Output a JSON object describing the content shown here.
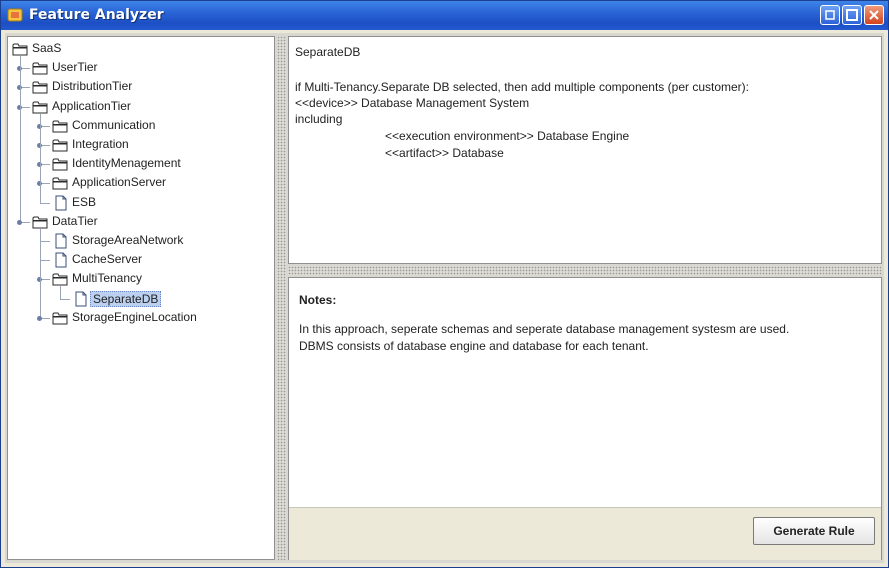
{
  "window": {
    "title": "Feature Analyzer"
  },
  "tree": {
    "nodes": [
      {
        "label": "SaaS",
        "type": "folder",
        "depth": 0
      },
      {
        "label": "UserTier",
        "type": "folder",
        "depth": 1,
        "toggle": true
      },
      {
        "label": "DistributionTier",
        "type": "folder",
        "depth": 1,
        "toggle": true
      },
      {
        "label": "ApplicationTier",
        "type": "folder",
        "depth": 1,
        "toggle": true,
        "expanded": true
      },
      {
        "label": "Communication",
        "type": "folder",
        "depth": 2,
        "toggle": true
      },
      {
        "label": "Integration",
        "type": "folder",
        "depth": 2,
        "toggle": true
      },
      {
        "label": "IdentityMenagement",
        "type": "folder",
        "depth": 2,
        "toggle": true
      },
      {
        "label": "ApplicationServer",
        "type": "folder",
        "depth": 2,
        "toggle": true
      },
      {
        "label": "ESB",
        "type": "file",
        "depth": 2
      },
      {
        "label": "DataTier",
        "type": "folder",
        "depth": 1,
        "toggle": true,
        "expanded": true
      },
      {
        "label": "StorageAreaNetwork",
        "type": "file",
        "depth": 2
      },
      {
        "label": "CacheServer",
        "type": "file",
        "depth": 2
      },
      {
        "label": "MultiTenancy",
        "type": "folder",
        "depth": 2,
        "toggle": true,
        "expanded": true
      },
      {
        "label": "SeparateDB",
        "type": "file",
        "depth": 3,
        "selected": true
      },
      {
        "label": "StorageEngineLocation",
        "type": "folder",
        "depth": 2,
        "toggle": true
      }
    ]
  },
  "description": {
    "title": "SeparateDB",
    "line1": "if Multi-Tenancy.Separate DB selected, then add multiple components (per customer):",
    "line2": "<<device>> Database Management System",
    "line3": "including",
    "line4": "<<execution environment>> Database Engine",
    "line5": "<<artifact>> Database"
  },
  "notes": {
    "heading": "Notes:",
    "line1": "In this approach, seperate schemas and seperate database management systesm are used.",
    "line2": "DBMS consists of database engine and database for each tenant."
  },
  "buttons": {
    "generate_rule": "Generate Rule"
  },
  "colors": {
    "titlebar": "#2a64d6",
    "selection": "#bcd0f0"
  }
}
